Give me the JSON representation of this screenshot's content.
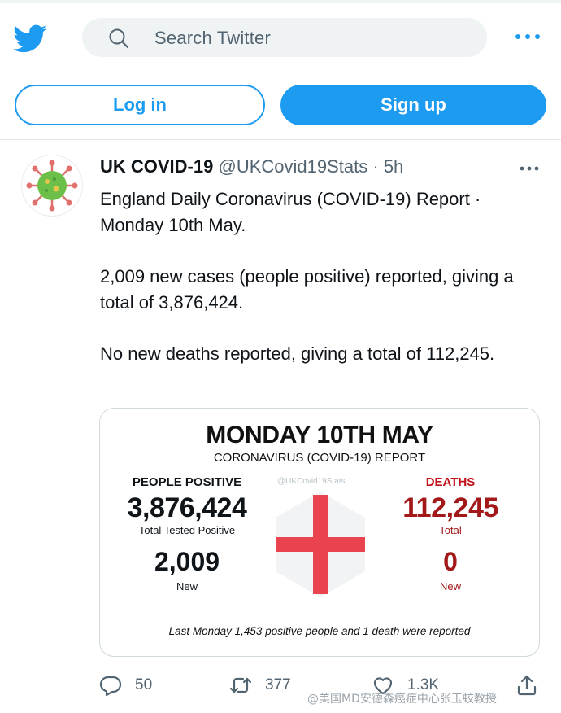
{
  "header": {
    "search_placeholder": "Search Twitter",
    "login_label": "Log in",
    "signup_label": "Sign up"
  },
  "tweet": {
    "author_name": "UK COVID-19",
    "author_handle": "@UKCovid19Stats",
    "separator": "·",
    "time": "5h",
    "text_line_1": "England Daily Coronavirus (COVID-19) Report · Monday 10th May.",
    "text_line_2": "2,009 new cases (people positive) reported, giving a total of 3,876,424.",
    "text_line_3": "No new deaths reported, giving a total of 112,245.",
    "card": {
      "title": "MONDAY 10TH MAY",
      "subtitle": "CORONAVIRUS (COVID-19) REPORT",
      "watermark": "@UKCovid19Stats",
      "positive_label": "PEOPLE POSITIVE",
      "positive_total": "3,876,424",
      "positive_total_label": "Total Tested Positive",
      "positive_new": "2,009",
      "positive_new_label": "New",
      "deaths_label": "DEATHS",
      "deaths_total": "112,245",
      "deaths_total_label": "Total",
      "deaths_new": "0",
      "deaths_new_label": "New",
      "footer": "Last Monday 1,453 positive people and 1 death were reported"
    },
    "actions": {
      "replies": "50",
      "retweets": "377",
      "likes": "1.3K"
    }
  },
  "overlay": {
    "weibo_watermark": "@美国MD安德森癌症中心张玉蛟教授"
  },
  "colors": {
    "twitter_blue": "#1d9bf0",
    "deaths_red": "#c0101a",
    "flag_red": "#e8434f"
  },
  "icons": [
    "twitter-bird-icon",
    "search-icon",
    "more-icon",
    "virus-avatar-icon",
    "england-flag-icon",
    "reply-icon",
    "retweet-icon",
    "like-icon",
    "share-icon"
  ]
}
